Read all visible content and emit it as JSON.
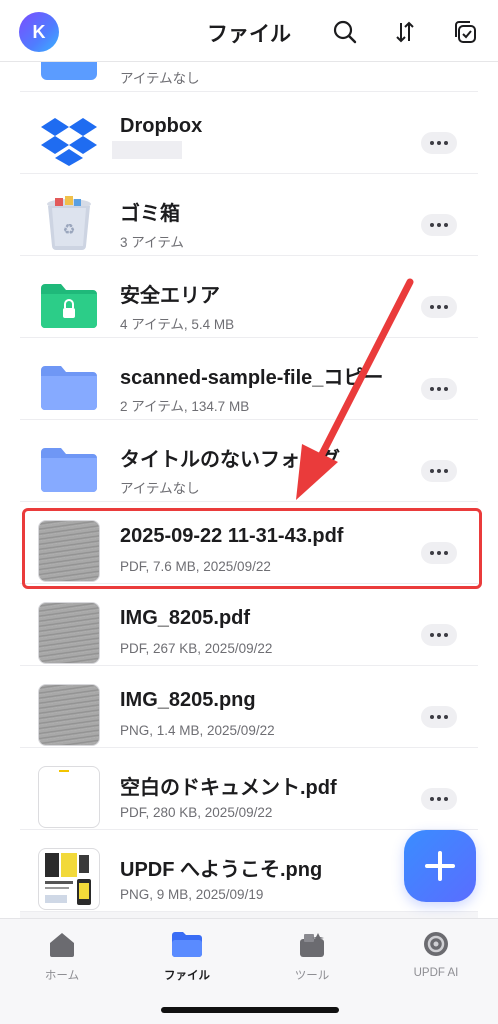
{
  "header": {
    "avatar_letter": "K",
    "title": "ファイル",
    "icons": [
      "search-icon",
      "sort-icon",
      "select-icon"
    ]
  },
  "files": [
    {
      "name": "",
      "meta": "アイテムなし",
      "kind": "cloud-folder"
    },
    {
      "name": "Dropbox",
      "meta": "",
      "kind": "dropbox"
    },
    {
      "name": "ゴミ箱",
      "meta": "3 アイテム",
      "kind": "trash"
    },
    {
      "name": "安全エリア",
      "meta": "4 アイテム, 5.4 MB",
      "kind": "secure-folder"
    },
    {
      "name": "scanned-sample-file_コピー",
      "meta": "2 アイテム, 134.7 MB",
      "kind": "folder"
    },
    {
      "name": "タイトルのないフォルダ",
      "meta": "アイテムなし",
      "kind": "folder"
    },
    {
      "name": "2025-09-22 11-31-43.pdf",
      "meta": "PDF, 7.6 MB, 2025/09/22",
      "kind": "doc"
    },
    {
      "name": "IMG_8205.pdf",
      "meta": "PDF, 267 KB, 2025/09/22",
      "kind": "doc"
    },
    {
      "name": "IMG_8205.png",
      "meta": "PNG, 1.4 MB, 2025/09/22",
      "kind": "doc"
    },
    {
      "name": "空白のドキュメント.pdf",
      "meta": "PDF, 280 KB, 2025/09/22",
      "kind": "blank"
    },
    {
      "name": "UPDF へようこそ.png",
      "meta": "PNG, 9 MB, 2025/09/19",
      "kind": "promo"
    }
  ],
  "tabs": [
    {
      "label": "ホーム",
      "icon": "home-icon"
    },
    {
      "label": "ファイル",
      "icon": "folder-icon",
      "active": true
    },
    {
      "label": "ツール",
      "icon": "tools-icon"
    },
    {
      "label": "UPDF AI",
      "icon": "ai-icon"
    }
  ],
  "colors": {
    "accent": "#3a7bff",
    "folder": "#7ea6ff",
    "secure": "#22c27a",
    "highlight": "#ea3b3b"
  }
}
